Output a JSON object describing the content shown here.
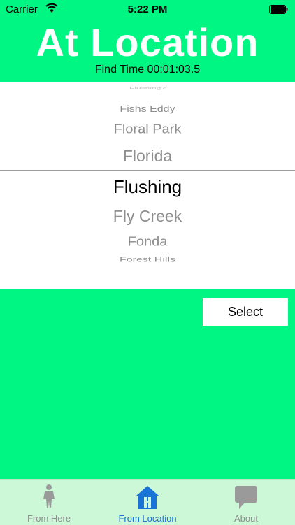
{
  "status_bar": {
    "carrier": "Carrier",
    "time": "5:22 PM"
  },
  "header": {
    "title": "At Location",
    "find_time": "Find Time 00:01:03.5"
  },
  "picker": {
    "rows": [
      "Flushing?",
      "Fishs Eddy",
      "Floral Park",
      "Florida",
      "Flushing",
      "Fly Creek",
      "Fonda",
      "Forest Hills"
    ],
    "selected": "Flushing"
  },
  "select_button": "Select",
  "tabs": [
    {
      "label": "From Here",
      "icon": "person-icon",
      "active": false
    },
    {
      "label": "From Location",
      "icon": "house-icon",
      "active": true
    },
    {
      "label": "About",
      "icon": "speech-bubble-icon",
      "active": false
    }
  ],
  "colors": {
    "background": "#00f682",
    "tab_bar": "#ccf8d8",
    "active_tab": "#1a73d6"
  }
}
